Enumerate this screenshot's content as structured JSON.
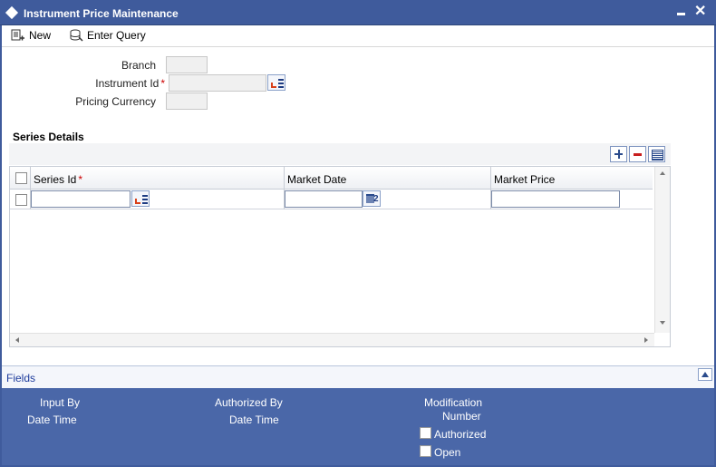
{
  "window": {
    "title": "Instrument Price Maintenance",
    "minimize_icon": "minimize-icon",
    "close_label": "✕"
  },
  "toolbar": {
    "new_label": "New",
    "enter_query_label": "Enter Query"
  },
  "form": {
    "branch_label": "Branch",
    "branch_value": "",
    "instrument_id_label": "Instrument Id",
    "instrument_id_required": "*",
    "instrument_id_value": "",
    "pricing_currency_label": "Pricing Currency",
    "pricing_currency_value": ""
  },
  "series": {
    "section_title": "Series Details",
    "columns": {
      "series_id": "Series Id",
      "series_id_required": "*",
      "market_date": "Market Date",
      "market_price": "Market Price"
    },
    "calendar_day": "2",
    "rows": [
      {
        "series_id": "",
        "market_date": "",
        "market_price": ""
      }
    ]
  },
  "fields_bar": {
    "label": "Fields"
  },
  "audit": {
    "input_by": "Input By",
    "date_time_1": "Date Time",
    "authorized_by": "Authorized By",
    "date_time_2": "Date Time",
    "modification": "Modification",
    "number": "Number",
    "authorized": "Authorized",
    "open": "Open"
  },
  "colors": {
    "title_bar": "#3f5b9c",
    "audit_panel": "#4a67a8",
    "required": "#cc0000",
    "link": "#1e3c9c"
  }
}
